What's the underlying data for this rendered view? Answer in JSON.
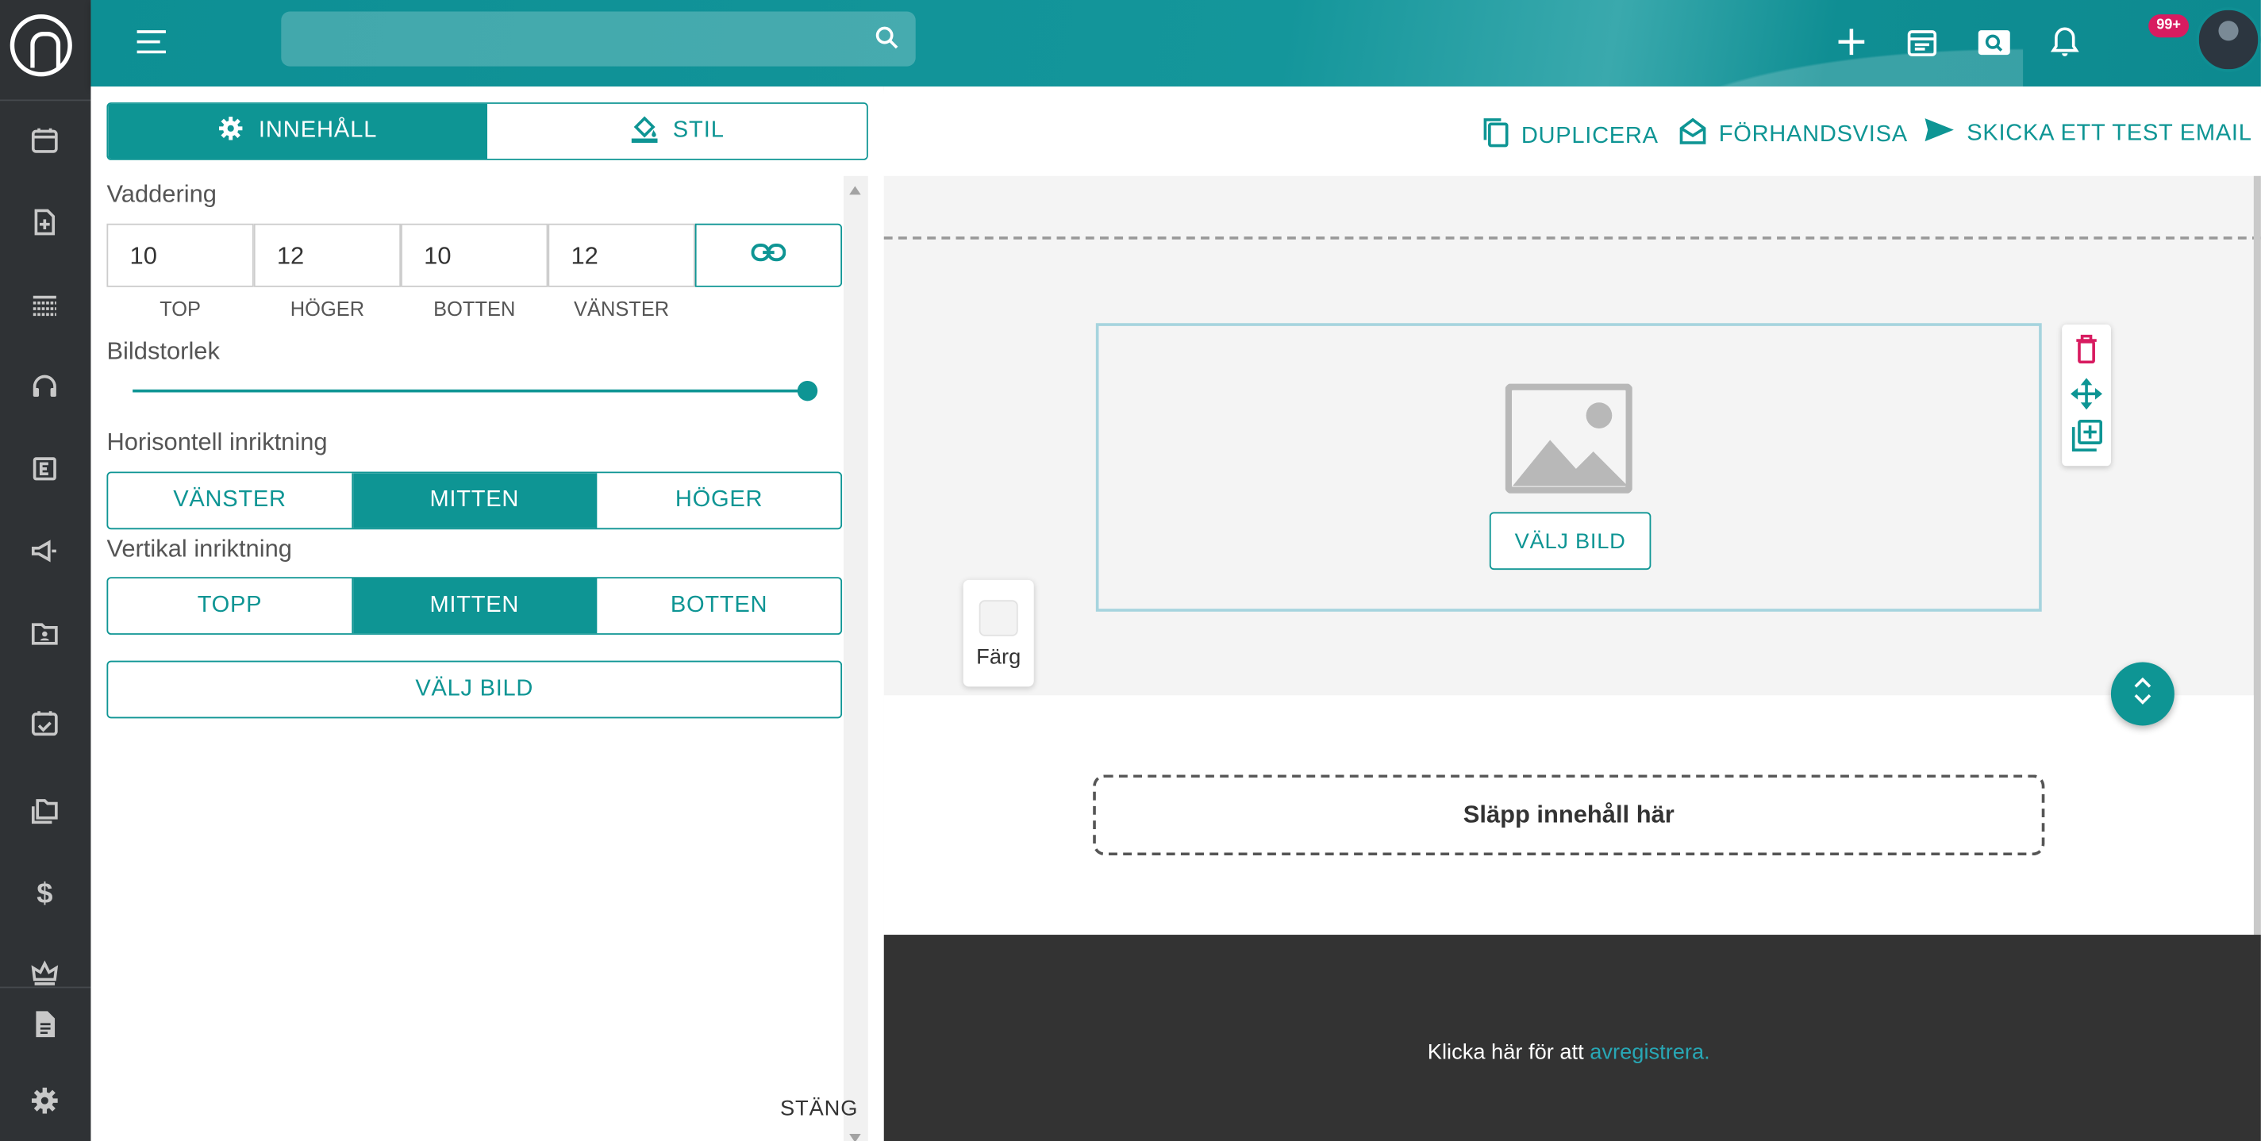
{
  "sidebar": {
    "logo": "n-logo",
    "items": [
      {
        "icon": "calendar-icon"
      },
      {
        "icon": "add-document-icon"
      },
      {
        "icon": "table-icon"
      },
      {
        "icon": "headset-icon"
      },
      {
        "icon": "e-letter-icon"
      },
      {
        "icon": "megaphone-icon"
      },
      {
        "icon": "contact-folder-icon"
      },
      {
        "icon": "calendar-check-icon"
      },
      {
        "icon": "folders-icon"
      },
      {
        "icon": "dollar-icon"
      },
      {
        "icon": "crown-icon"
      },
      {
        "icon": "document-icon"
      },
      {
        "icon": "gear-icon"
      }
    ]
  },
  "topbar": {
    "search_placeholder": "",
    "notification_badge": "99+",
    "help": "?"
  },
  "left_panel": {
    "tabs": [
      {
        "label": "INNEHÅLL",
        "icon": "gear-icon",
        "active": true
      },
      {
        "label": "STIL",
        "icon": "paint-bucket-icon",
        "active": false
      }
    ],
    "padding": {
      "label": "Vaddering",
      "values": [
        "10",
        "12",
        "10",
        "12"
      ],
      "labels": [
        "TOP",
        "HÖGER",
        "BOTTEN",
        "VÄNSTER"
      ]
    },
    "image_size": {
      "label": "Bildstorlek",
      "value": 1.0
    },
    "horizontal": {
      "label": "Horisontell inriktning",
      "options": [
        "VÄNSTER",
        "MITTEN",
        "HÖGER"
      ],
      "selected": "MITTEN"
    },
    "vertical": {
      "label": "Vertikal inriktning",
      "options": [
        "TOPP",
        "MITTEN",
        "BOTTEN"
      ],
      "selected": "MITTEN"
    },
    "choose_image": "VÄLJ BILD",
    "close": "STÄNG"
  },
  "actions": {
    "duplicate": "DUPLICERA",
    "preview": "FÖRHANDSVISA",
    "send_test": "SKICKA ETT TEST EMAIL"
  },
  "canvas": {
    "choose_image": "VÄLJ BILD",
    "color_label": "Färg",
    "drop_here": "Släpp innehåll här",
    "footer_text": "Klicka här för att ",
    "footer_link": "avregistrera."
  },
  "colors": {
    "accent": "#0e9594",
    "sidebar": "#2f3235",
    "badge": "#d81b60",
    "delete": "#d81b60"
  }
}
